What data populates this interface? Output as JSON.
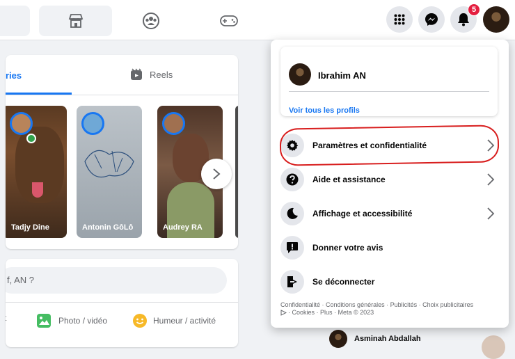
{
  "topbar": {
    "notification_count": "5",
    "icons": [
      "store-icon",
      "groups-icon",
      "gaming-icon",
      "menu-grid-icon",
      "messenger-icon",
      "bell-icon"
    ]
  },
  "stories": {
    "tabs": [
      {
        "label": "ries"
      },
      {
        "label": "Reels"
      }
    ],
    "items": [
      {
        "name": "Tadjy Dine"
      },
      {
        "name": "Antonin GôLô"
      },
      {
        "name": "Audrey RA"
      }
    ]
  },
  "post": {
    "placeholder": "f, AN ?",
    "left_stub": "t",
    "actions": [
      {
        "label": "Photo / vidéo"
      },
      {
        "label": "Humeur / activité"
      }
    ]
  },
  "menu": {
    "profile": {
      "name": "Ibrahim AN",
      "link": "Voir tous les profils"
    },
    "items": [
      {
        "label": "Paramètres et confidentialité"
      },
      {
        "label": "Aide et assistance"
      },
      {
        "label": "Affichage et accessibilité"
      },
      {
        "label": "Donner votre avis"
      },
      {
        "label": "Se déconnecter"
      }
    ],
    "footer_line1": "Confidentialité · Conditions générales · Publicités · Choix publicitaires",
    "footer_line2": "· Cookies · Plus · Meta © 2023"
  },
  "contacts": [
    {
      "name": "Asminah Abdallah"
    }
  ],
  "colors": {
    "accent": "#1877f2",
    "highlight_annotation": "#d81e1e",
    "badge": "#e41e3f"
  }
}
